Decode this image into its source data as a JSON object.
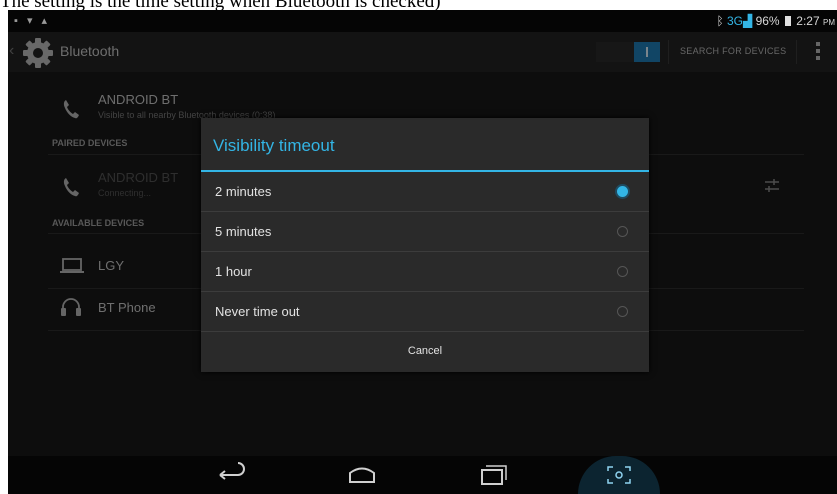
{
  "caption": "The setting is the time setting when Bluetooth is checked)",
  "status_bar": {
    "network": "3G",
    "battery": "96%",
    "time": "2:27",
    "ampm": "PM"
  },
  "action_bar": {
    "title": "Bluetooth",
    "search_label": "SEARCH FOR DEVICES"
  },
  "device": {
    "name": "ANDROID BT",
    "visibility": "Visible to all nearby Bluetooth devices (0:38)"
  },
  "paired": {
    "header": "PAIRED DEVICES",
    "items": [
      {
        "name": "ANDROID BT",
        "status": "Connecting..."
      }
    ]
  },
  "available": {
    "header": "AVAILABLE DEVICES",
    "items": [
      {
        "name": "LGY",
        "icon": "laptop-icon"
      },
      {
        "name": "BT Phone",
        "icon": "headset-icon"
      }
    ]
  },
  "dialog": {
    "title": "Visibility timeout",
    "options": [
      {
        "label": "2 minutes",
        "selected": true
      },
      {
        "label": "5 minutes",
        "selected": false
      },
      {
        "label": "1 hour",
        "selected": false
      },
      {
        "label": "Never time out",
        "selected": false
      }
    ],
    "cancel_label": "Cancel"
  },
  "colors": {
    "accent": "#33b5e5",
    "background": "#191919",
    "dialog": "#2a2a2a"
  }
}
